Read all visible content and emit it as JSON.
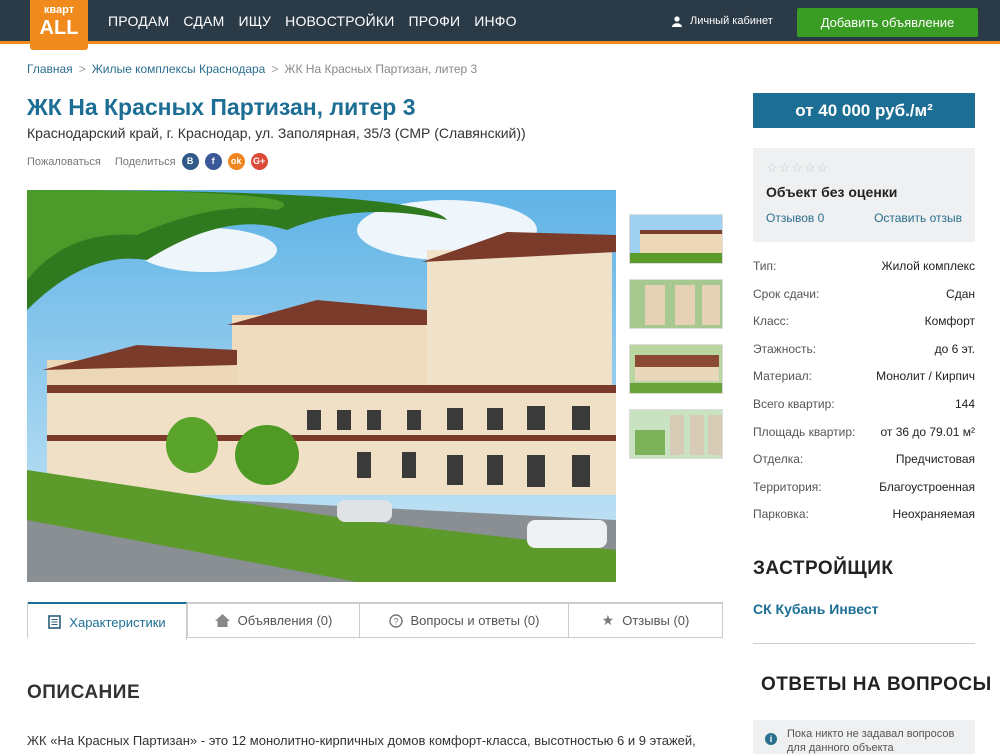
{
  "header": {
    "logo_top": "кварт",
    "logo_bottom": "ALL",
    "nav": [
      "ПРОДАМ",
      "СДАМ",
      "ИЩУ",
      "НОВОСТРОЙКИ",
      "ПРОФИ",
      "ИНФО"
    ],
    "cabinet": "Личный кабинет",
    "add_button": "Добавить объявление"
  },
  "breadcrumbs": [
    "Главная",
    "Жилые комплексы Краснодара",
    "ЖК На Красных Партизан, литер 3"
  ],
  "title": "ЖК На Красных Партизан, литер 3",
  "address": "Краснодарский край, г. Краснодар, ул. Заполярная, 35/3 (СМР (Славянский))",
  "social": {
    "complain": "Пожаловаться",
    "share": "Поделиться",
    "icons": [
      "В",
      "f",
      "ok",
      "G+"
    ]
  },
  "tabs": [
    {
      "label": "Характеристики",
      "icon": "list-icon"
    },
    {
      "label": "Объявления (0)",
      "icon": "house-icon"
    },
    {
      "label": "Вопросы и ответы (0)",
      "icon": "question-icon"
    },
    {
      "label": "Отзывы (0)",
      "icon": "star-icon"
    }
  ],
  "description": {
    "heading": "ОПИСАНИЕ",
    "text": "ЖК «На Красных Партизан» - это 12 монолитно-кирпичных домов комфорт-класса, высотностью 6 и 9 этажей,"
  },
  "price": "от 40 000 руб./м²",
  "rating": {
    "stars": "☆☆☆☆☆",
    "title": "Объект без оценки",
    "reviews": "Отзывов 0",
    "leave": "Оставить отзыв"
  },
  "props": [
    {
      "k": "Тип:",
      "v": "Жилой комплекс"
    },
    {
      "k": "Срок сдачи:",
      "v": "Сдан"
    },
    {
      "k": "Класс:",
      "v": "Комфорт"
    },
    {
      "k": "Этажность:",
      "v": "до 6 эт."
    },
    {
      "k": "Материал:",
      "v": "Монолит / Кирпич"
    },
    {
      "k": "Всего квартир:",
      "v": "144"
    },
    {
      "k": "Площадь квартир:",
      "v": "от 36 до 79.01 м²"
    },
    {
      "k": "Отделка:",
      "v": "Предчистовая"
    },
    {
      "k": "Территория:",
      "v": "Благоустроенная"
    },
    {
      "k": "Парковка:",
      "v": "Неохраняемая"
    }
  ],
  "developer": {
    "heading": "ЗАСТРОЙЩИК",
    "name": "СК Кубань Инвест"
  },
  "qa": {
    "heading": "ОТВЕТЫ НА ВОПРОСЫ",
    "note": "Пока никто не задавал вопросов для данного объекта"
  }
}
